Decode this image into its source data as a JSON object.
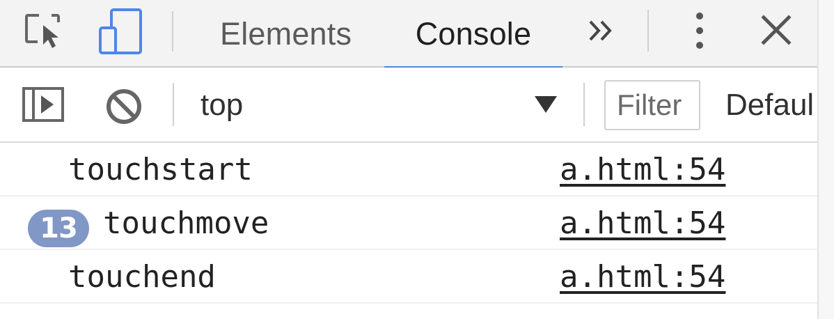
{
  "tabs": {
    "elements": "Elements",
    "console": "Console",
    "more": "»"
  },
  "toolbar": {
    "context": "top",
    "filter_placeholder": "Filter",
    "levels": "Defaul"
  },
  "messages": [
    {
      "text": "touchstart",
      "source": "a.html:54",
      "count": ""
    },
    {
      "text": "touchmove",
      "source": "a.html:54",
      "count": "13"
    },
    {
      "text": "touchend",
      "source": "a.html:54",
      "count": ""
    }
  ],
  "icons": {
    "inspect": "inspect-element-icon",
    "device": "device-toolbar-icon",
    "kebab": "more-options-icon",
    "close": "close-icon",
    "sidebar": "show-console-sidebar-icon",
    "clear": "clear-console-icon",
    "dropdown": "dropdown-arrow-icon"
  },
  "colors": {
    "accent": "#4d87e8",
    "badge": "#8197c6"
  }
}
